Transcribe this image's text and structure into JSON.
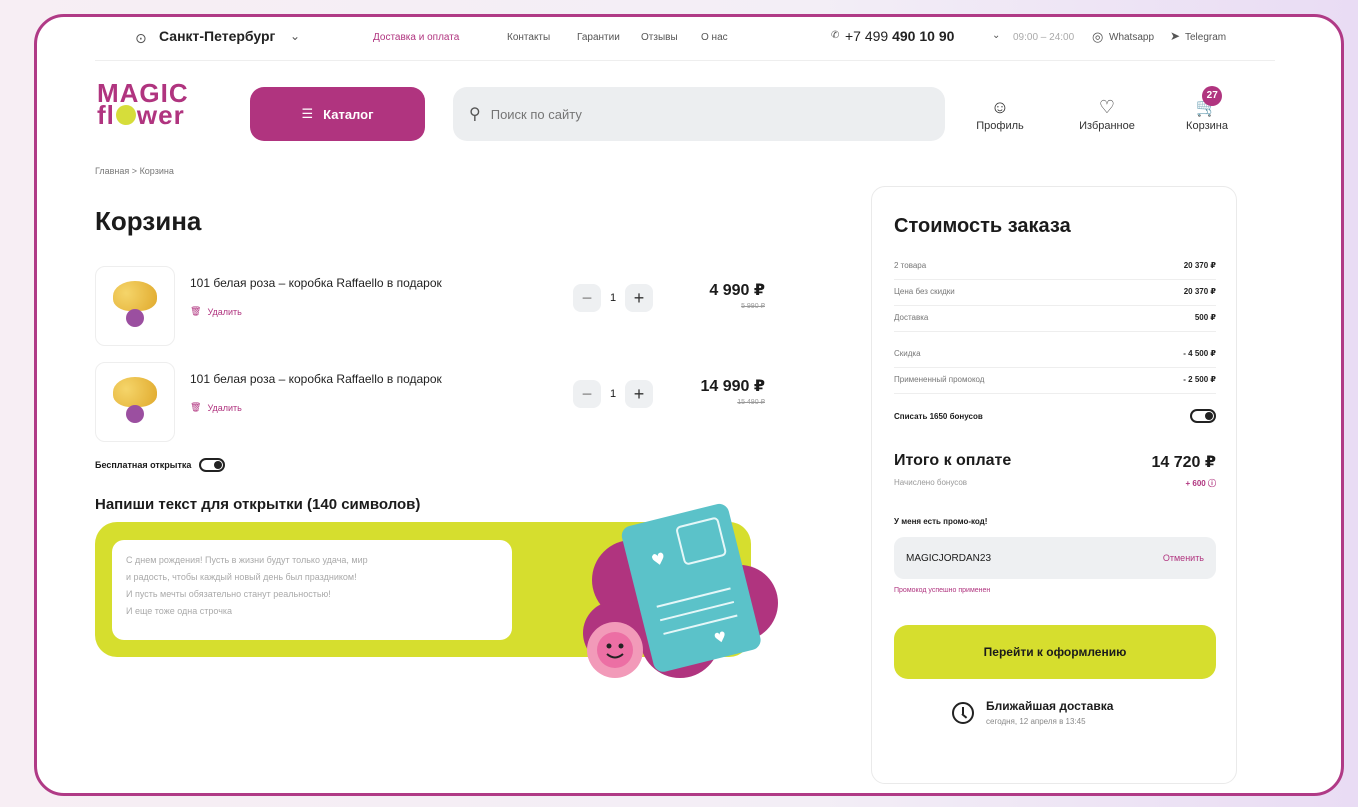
{
  "topbar": {
    "city": "Санкт-Петербург",
    "links": [
      "Доставка и оплата",
      "Контакты",
      "Гарантии",
      "Отзывы",
      "О нас"
    ],
    "phone_prefix": "+7 499",
    "phone_main": "490 10 90",
    "hours": "09:00 – 24:00",
    "whatsapp": "Whatsapp",
    "telegram": "Telegram"
  },
  "logo": {
    "line1": "MAGIC",
    "line2a": "fl",
    "line2b": "wer"
  },
  "header": {
    "catalog_label": "Каталог",
    "search_placeholder": "Поиск по сайту",
    "profile_label": "Профиль",
    "favorites_label": "Избранное",
    "cart_label": "Корзина",
    "cart_count": "27"
  },
  "breadcrumb": {
    "home": "Главная",
    "sep": ">",
    "current": "Корзина"
  },
  "page_title": "Корзина",
  "cart": {
    "items": [
      {
        "name": "101 белая роза – коробка Raffaello в подарок",
        "delete_label": "Удалить",
        "qty": "1",
        "price": "4 990 ₽",
        "old_price": "5 990 ₽"
      },
      {
        "name": "101 белая роза – коробка Raffaello в подарок",
        "delete_label": "Удалить",
        "qty": "1",
        "price": "14 990 ₽",
        "old_price": "15 490 ₽"
      }
    ],
    "free_card_label": "Бесплатная открытка",
    "card_text_title": "Напиши текст для открытки (140 символов)",
    "card_text_lines": [
      "С днем рождения! Пусть в жизни будут только удача, мир",
      "и радость, чтобы каждый новый день был праздником!",
      "И пусть мечты обязательно станут реальностью!",
      "И еще тоже одна строчка"
    ]
  },
  "summary": {
    "title": "Стоимость заказа",
    "rows": [
      {
        "label": "2 товара",
        "value": "20 370 ₽"
      },
      {
        "label": "Цена без скидки",
        "value": "20 370 ₽"
      },
      {
        "label": "Доставка",
        "value": "500 ₽"
      },
      {
        "label": "Скидка",
        "value": "- 4 500 ₽"
      },
      {
        "label": "Примененный промокод",
        "value": "- 2 500 ₽"
      }
    ],
    "bonus_label": "Списать 1650 бонусов",
    "total_label": "Итого к оплате",
    "total_value": "14 720 ₽",
    "accrued_label": "Начислено бонусов",
    "accrued_value": "+ 600",
    "promo_has_label": "У меня есть промо-код!",
    "promo_code": "MAGICJORDAN23",
    "promo_cancel": "Отменить",
    "promo_applied": "Промокод успешно применен",
    "checkout_label": "Перейти к оформлению",
    "delivery_title": "Ближайшая доставка",
    "delivery_sub": "сегодня, 12 апреля в 13:45"
  },
  "colors": {
    "brand": "#b0347f",
    "accent": "#d6de2e"
  }
}
